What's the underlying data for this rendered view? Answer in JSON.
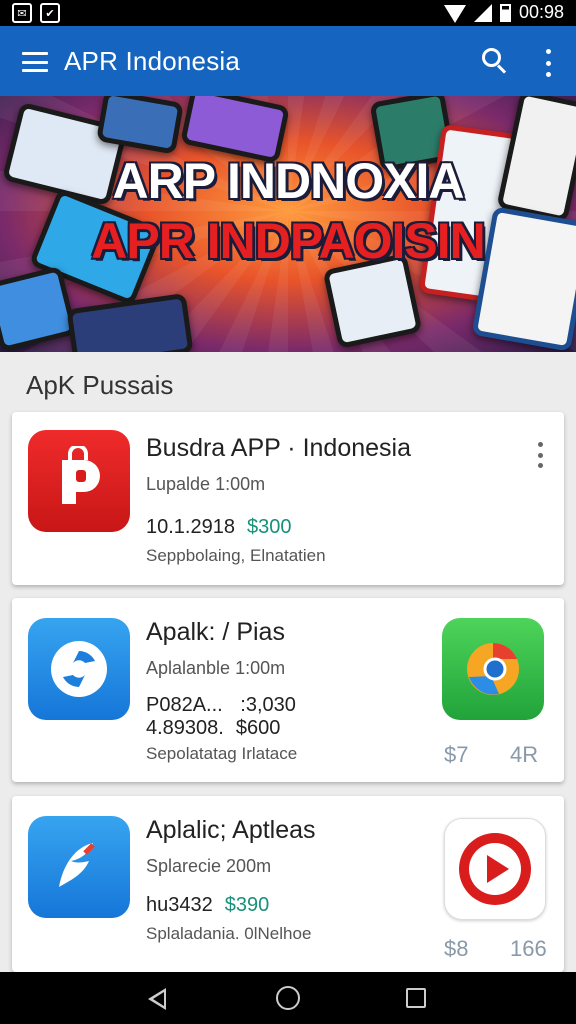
{
  "status_bar": {
    "time": "00:98",
    "left_icons": [
      "notification-icon",
      "shield-icon"
    ],
    "right_icons": [
      "wifi-icon",
      "signal-icon",
      "battery-icon"
    ]
  },
  "app_bar": {
    "title": "APR Indonesia",
    "icons": [
      "menu-icon",
      "search-icon",
      "more-vert-icon"
    ],
    "color": "#1565c0"
  },
  "banner": {
    "line1": "ARP INDNOXIA",
    "line2": "APR INDPAOISIN"
  },
  "section": {
    "title": "ApK Pussais"
  },
  "cards": [
    {
      "icon": "parking-bag-icon",
      "name": "Busdra APP · Indonesia",
      "meta": "Lupalde  1:00m",
      "line1_code": "10.1.2918",
      "line1_price": "$300",
      "sub": "Seppbolaing, Elnatatien"
    },
    {
      "icon": "refresh-s-icon",
      "side_icon": "browser-globe-icon",
      "name": "Apalk: / Pias",
      "meta": "Aplalanble 1:00m",
      "line1_code": "P082A...",
      "line1_value": ":3,030",
      "line2_code": "4.89308.",
      "line2_price": "$600",
      "sub": "Sepolatatag Irlatace",
      "corner_left": "$7",
      "corner_right": "4R"
    },
    {
      "icon": "feather-icon",
      "side_icon": "play-bubble-icon",
      "name": "Aplalic; Aptleas",
      "meta": "Splarecie  200m",
      "line1_code": "hu3432",
      "line1_price": "$390",
      "sub": "Splaladania. 0lNelhoe",
      "corner_left": "$8",
      "corner_right": "166"
    }
  ],
  "nav_bar": {
    "icons": [
      "back-icon",
      "home-icon",
      "recents-icon"
    ]
  }
}
